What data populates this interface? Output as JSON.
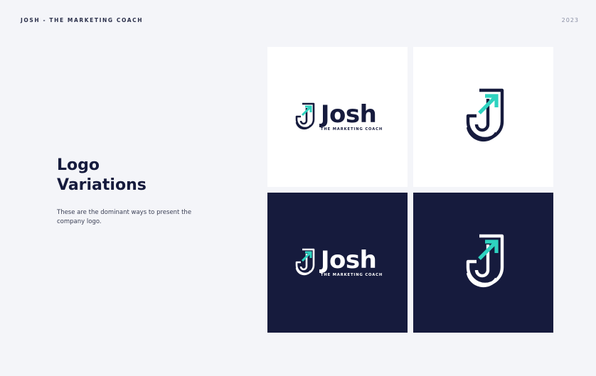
{
  "header": {
    "brand": "JOSH - THE MARKETING COACH",
    "year": "2023"
  },
  "content": {
    "title_line1": "Logo",
    "title_line2": "Variations",
    "description": "These are the dominant ways to present the company logo."
  },
  "logo": {
    "name": "Josh",
    "tagline": "THE MARKETING COACH",
    "accent_color": "#2ed3c0",
    "navy_color": "#161b3d",
    "white_color": "#ffffff"
  },
  "variations": [
    {
      "background": "light",
      "type": "full-lockup"
    },
    {
      "background": "light",
      "type": "icon-only"
    },
    {
      "background": "dark",
      "type": "full-lockup"
    },
    {
      "background": "dark",
      "type": "icon-only"
    }
  ]
}
